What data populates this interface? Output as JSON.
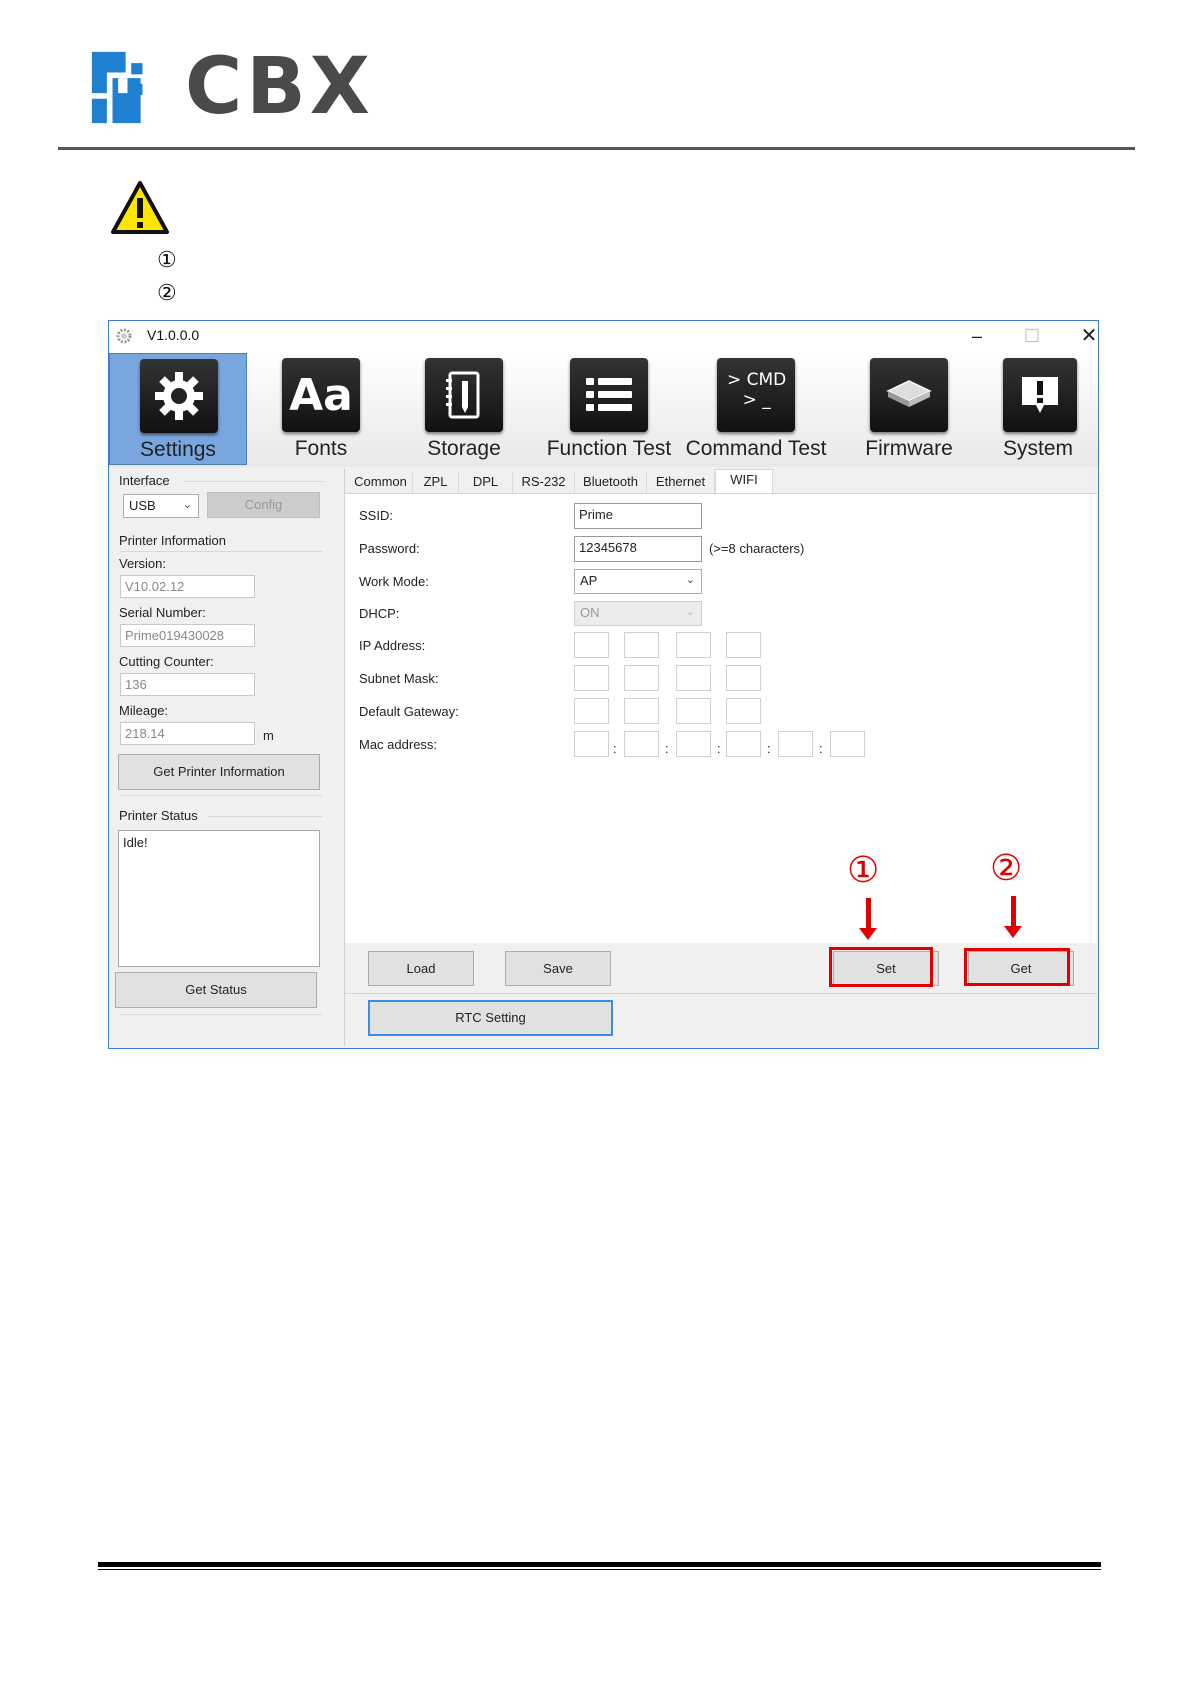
{
  "doc": {
    "logo_text": "CBX",
    "notes": [
      "①",
      "②"
    ]
  },
  "window": {
    "title": "V1.0.0.0",
    "controls": {
      "minimize": "–",
      "maximize": "☐",
      "close": "✕"
    }
  },
  "toolbar": {
    "items": [
      {
        "label": "Settings",
        "icon": "gear-icon",
        "active": true
      },
      {
        "label": "Fonts",
        "icon": "fonts-icon",
        "tile_text": "Aa"
      },
      {
        "label": "Storage",
        "icon": "storage-icon"
      },
      {
        "label": "Function Test",
        "icon": "list-icon"
      },
      {
        "label": "Command Test",
        "icon": "cmd-icon",
        "tile_text": "> CMD\n> _"
      },
      {
        "label": "Firmware",
        "icon": "chip-icon"
      },
      {
        "label": "System",
        "icon": "system-alert-icon"
      }
    ]
  },
  "left": {
    "interface": {
      "title": "Interface",
      "select_value": "USB",
      "config_label": "Config"
    },
    "printer_info": {
      "title": "Printer Information",
      "version_label": "Version:",
      "version_value": "V10.02.12",
      "serial_label": "Serial Number:",
      "serial_value": "Prime019430028",
      "cutting_label": "Cutting Counter:",
      "cutting_value": "136",
      "mileage_label": "Mileage:",
      "mileage_value": "218.14",
      "mileage_unit": "m",
      "get_info_label": "Get Printer Information"
    },
    "printer_status": {
      "title": "Printer Status",
      "status_text": "Idle!",
      "get_status_label": "Get Status"
    }
  },
  "right": {
    "tabs": [
      "Common",
      "ZPL",
      "DPL",
      "RS-232",
      "Bluetooth",
      "Ethernet",
      "WIFI"
    ],
    "active_tab": "WIFI",
    "wifi": {
      "ssid_label": "SSID:",
      "ssid_value": "Prime",
      "password_label": "Password:",
      "password_value": "12345678",
      "password_hint": "(>=8 characters)",
      "work_mode_label": "Work Mode:",
      "work_mode_value": "AP",
      "dhcp_label": "DHCP:",
      "dhcp_value": "ON",
      "ip_label": "IP Address:",
      "subnet_label": "Subnet Mask:",
      "gateway_label": "Default Gateway:",
      "mac_label": "Mac address:",
      "mac_separator": ":"
    },
    "buttons": {
      "load": "Load",
      "save": "Save",
      "set": "Set",
      "get": "Get",
      "rtc": "RTC Setting"
    },
    "annotations": {
      "set_marker": "①",
      "get_marker": "②"
    }
  },
  "colors": {
    "highlight": "#e00000",
    "active_tool": "#7aa6e0",
    "window_border": "#3c7fd4"
  }
}
